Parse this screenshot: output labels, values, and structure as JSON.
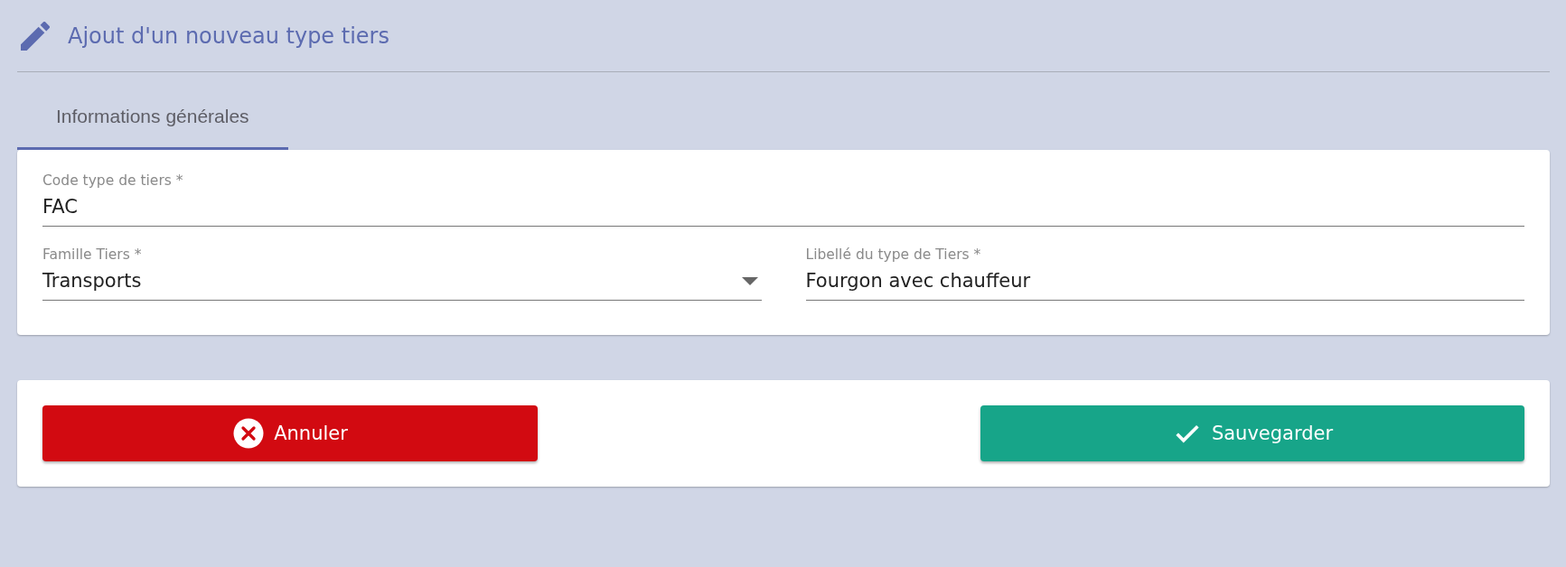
{
  "header": {
    "title": "Ajout d'un nouveau type tiers"
  },
  "tabs": [
    {
      "label": "Informations générales",
      "selected": true
    }
  ],
  "form": {
    "rows": [
      [
        {
          "kind": "text",
          "label": "Code type de tiers *",
          "value": "FAC"
        }
      ],
      [
        {
          "kind": "select",
          "label": "Famille Tiers *",
          "value": "Transports"
        },
        {
          "kind": "text",
          "label": "Libellé du type de Tiers *",
          "value": "Fourgon avec chauffeur"
        }
      ]
    ]
  },
  "buttons": [
    {
      "kind": "cancel",
      "label": "Annuler"
    },
    {
      "kind": "save",
      "label": "Sauvegarder"
    }
  ]
}
